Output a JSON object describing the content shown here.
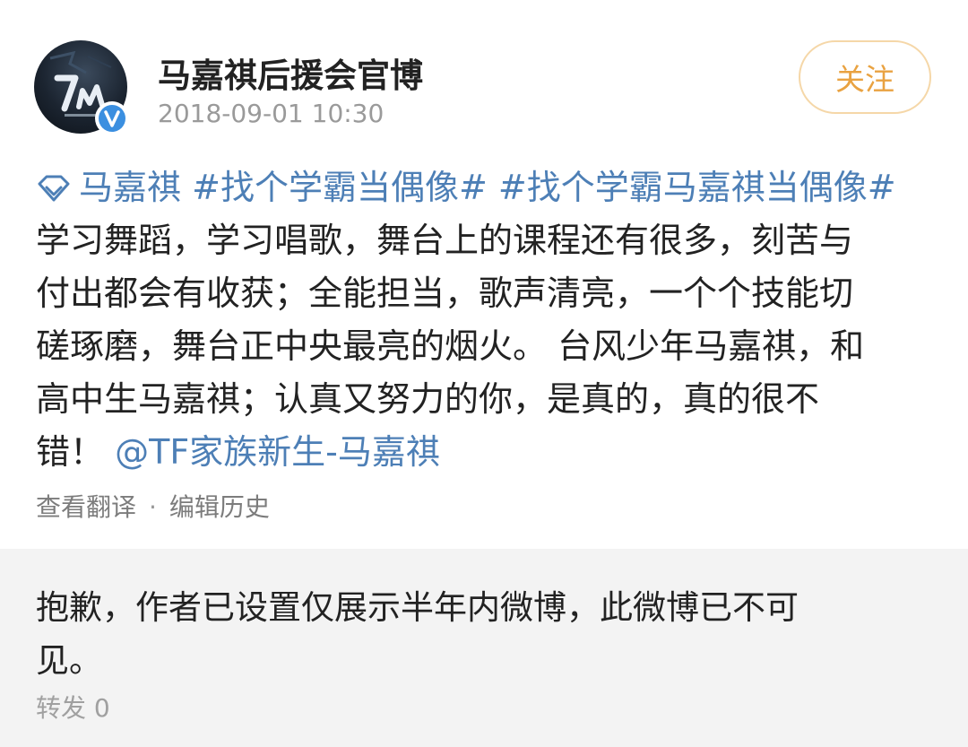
{
  "post": {
    "avatar_icon": "7m-fan-club-logo",
    "verified_icon": "verified-v-badge",
    "author": "马嘉祺后援会官博",
    "timestamp": "2018-09-01 10:30",
    "follow_label": "关注",
    "colors": {
      "link": "#4d7fb6",
      "follow_text": "#e9a241",
      "follow_border": "#f5d7a8",
      "verified_badge": "#3b8fe0",
      "notice_bg": "#f3f3f3"
    },
    "body": {
      "super_topic_icon": "diamond-icon",
      "super_topic": "马嘉祺",
      "hashtag_1": "#找个学霸当偶像#",
      "hashtag_2": "#找个学霸马嘉祺当偶像#",
      "text_line_1": "学习舞蹈，学习唱歌，舞台上的课程还有很多，刻苦与",
      "text_line_2": "付出都会有收获；全能担当，歌声清亮，一个个技能切",
      "text_line_3": "磋琢磨，舞台正中央最亮的烟火。 台风少年马嘉祺，和",
      "text_line_4": "高中生马嘉祺；认真又努力的你，是真的，真的很不",
      "text_line_5": "错！",
      "mention": "@TF家族新生-马嘉祺"
    },
    "actions": {
      "translate": "查看翻译",
      "separator": "·",
      "edit_history": "编辑历史"
    }
  },
  "repost": {
    "notice_line_1": "抱歉，作者已设置仅展示半年内微博，此微博已不可",
    "notice_line_2": "见。",
    "forward_label": "转发 0"
  }
}
